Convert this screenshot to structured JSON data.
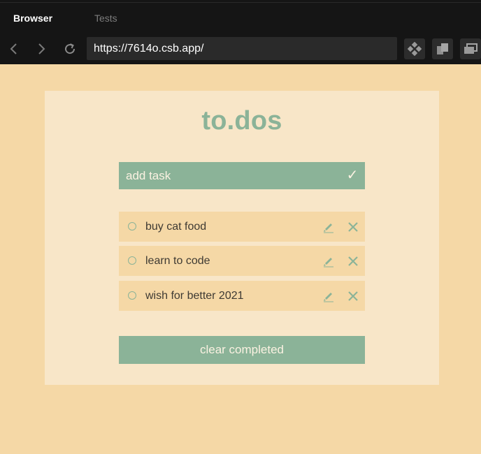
{
  "browser": {
    "tabs": [
      {
        "label": "Browser",
        "active": true
      },
      {
        "label": "Tests",
        "active": false
      }
    ],
    "url": "https://7614o.csb.app/",
    "icons": {
      "back": "chevron-left-icon",
      "forward": "chevron-right-icon",
      "reload": "reload-icon",
      "tool_1": "codesandbox-icon",
      "tool_2": "open-in-new-window-icon",
      "tool_3": "window-stack-icon"
    },
    "colors": {
      "chrome_bg": "#151515",
      "url_bg": "#2a2a2a"
    }
  },
  "app": {
    "title": "to.dos",
    "add": {
      "placeholder": "add task",
      "submit_icon": "check-icon"
    },
    "todos": [
      {
        "text": "buy cat food",
        "completed": false
      },
      {
        "text": "learn to code",
        "completed": false
      },
      {
        "text": "wish for better 2021",
        "completed": false
      }
    ],
    "clear_label": "clear completed",
    "colors": {
      "accent": "#8bb398",
      "page_bg": "#f5d8a6",
      "card_bg": "#f8e6c8",
      "item_bg": "#f5d8a6"
    }
  }
}
